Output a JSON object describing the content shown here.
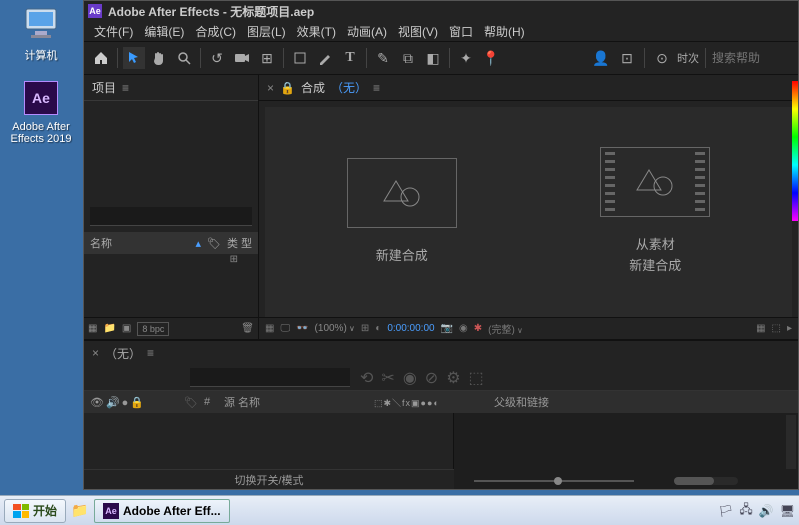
{
  "desktop": {
    "computer_label": "计算机",
    "ae_label": "Adobe After\nEffects 2019"
  },
  "app": {
    "title": "Adobe After Effects - 无标题项目.aep",
    "menu": [
      "文件(F)",
      "编辑(E)",
      "合成(C)",
      "图层(L)",
      "效果(T)",
      "动画(A)",
      "视图(V)",
      "窗口",
      "帮助(H)"
    ],
    "search_help_placeholder": "搜索帮助",
    "tool_timer": "时次",
    "project_panel": {
      "tab": "项目",
      "search_placeholder": "",
      "col_name": "名称",
      "col_type": "类 型",
      "bpc": "8 bpc"
    },
    "comp_panel": {
      "tab_prefix": "合成",
      "tab_none": "（无）",
      "new_comp": "新建合成",
      "from_footage_line1": "从素材",
      "from_footage_line2": "新建合成",
      "zoom": "(100%)",
      "time": "0:00:00:00",
      "res": "(完整)"
    },
    "timeline": {
      "tab": "（无）",
      "src_name": "源 名称",
      "parent_link": "父级和链接",
      "toggle_label": "切换开关/模式"
    }
  },
  "taskbar": {
    "start": "开始",
    "task_app": "Adobe After Eff..."
  }
}
